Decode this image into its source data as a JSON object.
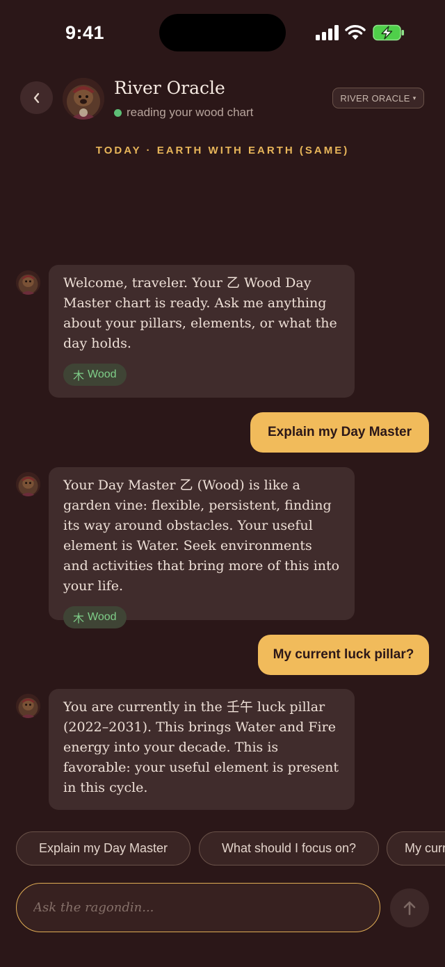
{
  "status_bar": {
    "time": "9:41",
    "icons": [
      "signal-icon",
      "wifi-icon",
      "battery-charging-icon"
    ]
  },
  "header": {
    "back_icon": "chevron-left-icon",
    "name": "River Oracle",
    "status": "reading your wood chart",
    "persona_dropdown": "RIVER ORACLE",
    "dropdown_caret": "▾"
  },
  "today_banner": "TODAY · EARTH WITH EARTH (SAME)",
  "messages": [
    {
      "role": "bot",
      "text": "Welcome, traveler. Your 乙 Wood Day Master chart is ready. Ask me anything about your pillars, elements, or what the day holds.",
      "tag": {
        "glyph": "木",
        "label": "Wood"
      }
    },
    {
      "role": "user",
      "text": "Explain my Day Master"
    },
    {
      "role": "bot",
      "text": "Your Day Master 乙 (Wood) is like a garden vine: flexible, persistent, finding its way around obstacles. Your useful element is Water. Seek environments and activities that bring more of this into your life.",
      "tag": {
        "glyph": "木",
        "label": "Wood"
      }
    },
    {
      "role": "user",
      "text": "My current luck pillar?"
    },
    {
      "role": "bot",
      "text": "You are currently in the 壬午 luck pillar (2022–2031). This brings Water and Fire energy into your decade. This is favorable: your useful element is present in this cycle."
    }
  ],
  "suggestions": [
    "Explain my Day Master",
    "What should I focus on?",
    "My current luck pillar?"
  ],
  "composer": {
    "placeholder": "Ask the ragondin...",
    "send_icon": "arrow-up-icon"
  },
  "colors": {
    "background": "#2b1718",
    "accent": "#f1bb5b",
    "bubble": "#402c2c",
    "wood": "#7fcf89",
    "online": "#5dbf76"
  }
}
